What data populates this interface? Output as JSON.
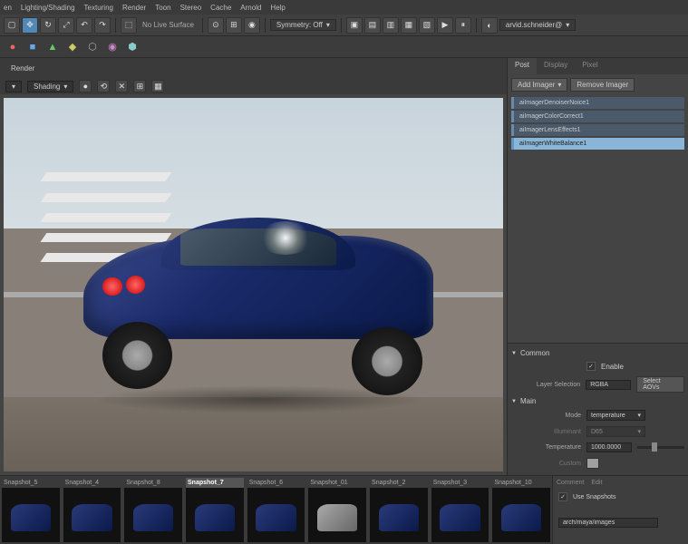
{
  "menu": {
    "items": [
      "en",
      "Lighting/Shading",
      "Texturing",
      "Render",
      "Toon",
      "Stereo",
      "Cache",
      "Arnold",
      "Help"
    ]
  },
  "toolbar": {
    "surface_label": "No Live Surface",
    "symmetry_label": "Symmetry: Off",
    "user": "arvid.schneider@"
  },
  "viewport": {
    "tab": "Render",
    "shading_label": "Shading"
  },
  "right_panel": {
    "tabs": [
      "Post",
      "Display",
      "Pixel"
    ],
    "active_tab": 0,
    "add_btn": "Add Imager",
    "remove_btn": "Remove Imager",
    "imagers": [
      {
        "name": "aiImagerDenoiserNoice1",
        "selected": false
      },
      {
        "name": "aiImagerColorCorrect1",
        "selected": false
      },
      {
        "name": "aiImagerLensEffects1",
        "selected": false
      },
      {
        "name": "aiImagerWhiteBalance1",
        "selected": true
      }
    ],
    "common": {
      "title": "Common",
      "enable_label": "Enable",
      "enable_value": true,
      "layer_label": "Layer Selection",
      "layer_value": "RGBA",
      "select_aovs_btn": "Select AOVs"
    },
    "main": {
      "title": "Main",
      "mode_label": "Mode",
      "mode_value": "temperature",
      "illuminant_label": "Illuminant",
      "illuminant_value": "D65",
      "temp_label": "Temperature",
      "temp_value": "1000.0000",
      "custom_label": "Custom"
    }
  },
  "snapshots": {
    "items": [
      {
        "label": "Snapshot_5"
      },
      {
        "label": "Snapshot_4"
      },
      {
        "label": "Snapshot_8"
      },
      {
        "label": "Snapshot_7",
        "active": true
      },
      {
        "label": "Snapshot_6"
      },
      {
        "label": "Snapshot_01",
        "silver": true
      },
      {
        "label": "Snapshot_2"
      },
      {
        "label": "Snapshot_3"
      },
      {
        "label": "Snapshot_10"
      }
    ]
  },
  "bottom_right": {
    "tabs": [
      "Comment",
      "Edit"
    ],
    "use_snapshots_label": "Use Snapshots",
    "use_snapshots_value": true,
    "path_value": "arch/maya/images"
  }
}
